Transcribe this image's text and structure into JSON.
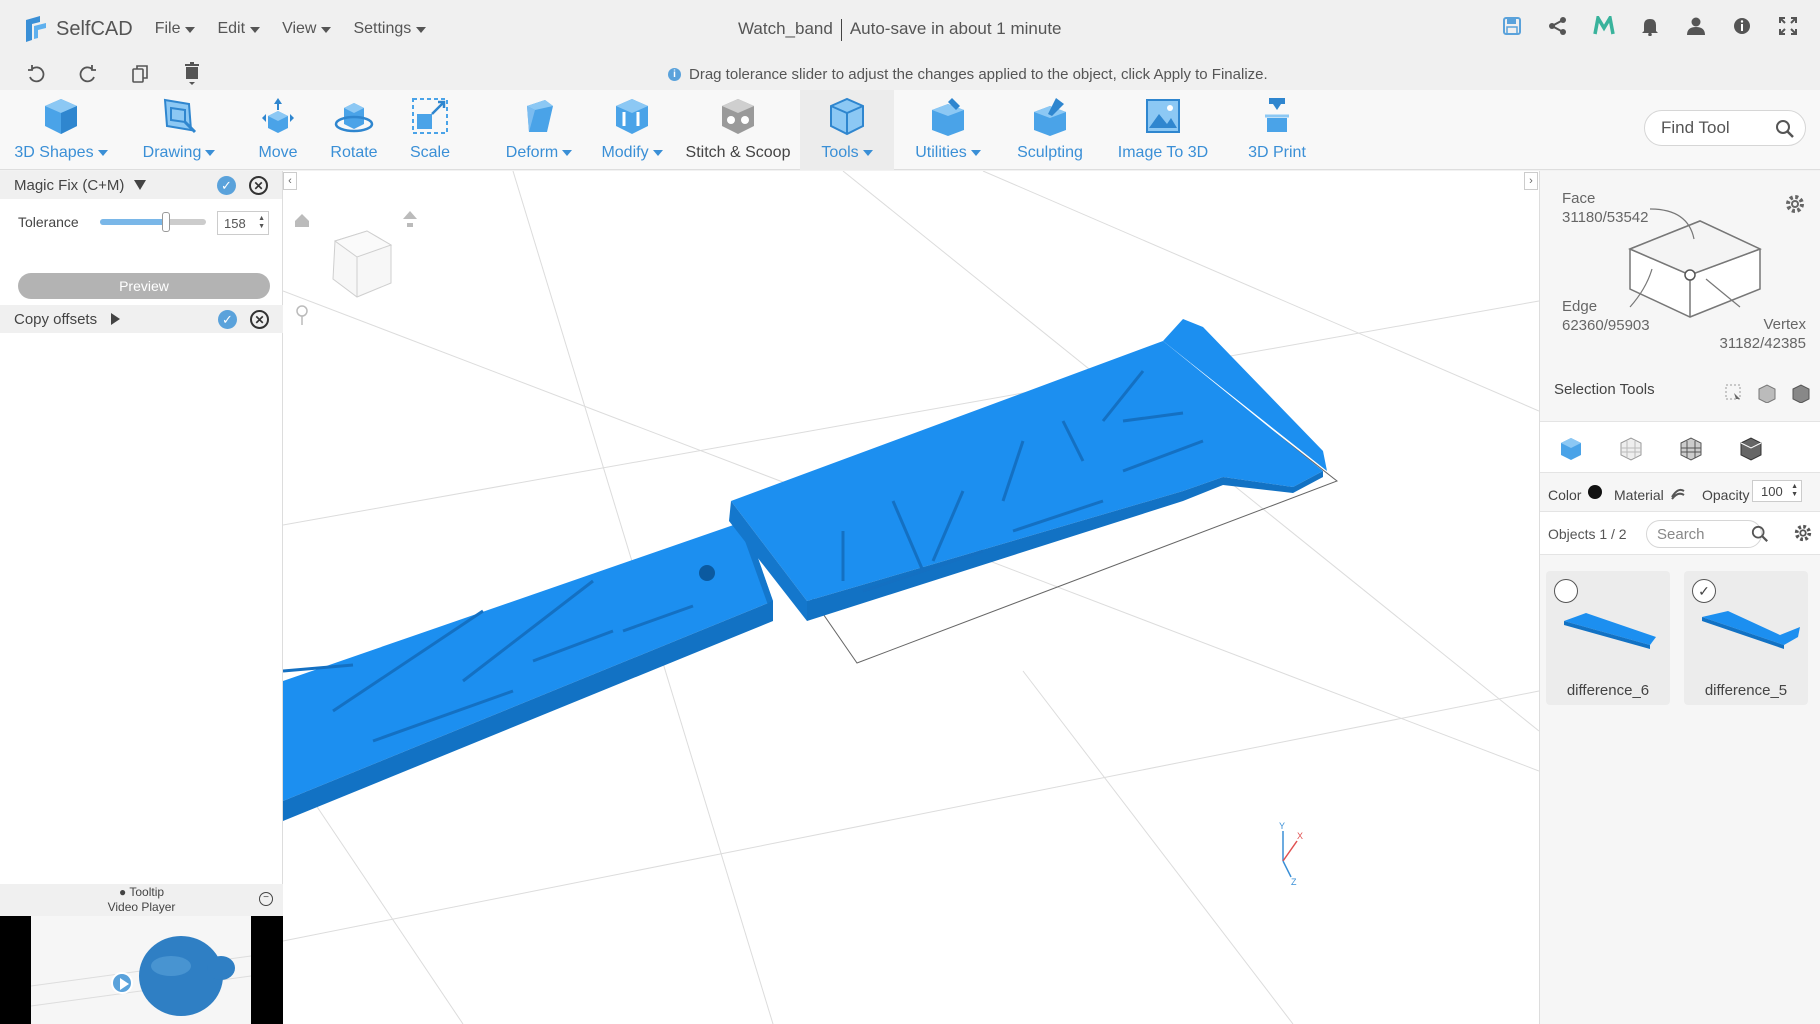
{
  "app": {
    "name": "SelfCAD",
    "file_name": "Watch_band",
    "autosave": "Auto-save in about 1 minute"
  },
  "menus": [
    "File",
    "Edit",
    "View",
    "Settings"
  ],
  "info_message": "Drag tolerance slider to adjust the changes applied to the object, click Apply to Finalize.",
  "toolbar": {
    "tools": [
      {
        "label": "3D Shapes",
        "dropdown": true
      },
      {
        "label": "Drawing",
        "dropdown": true
      },
      {
        "label": "Move",
        "dropdown": false
      },
      {
        "label": "Rotate",
        "dropdown": false
      },
      {
        "label": "Scale",
        "dropdown": false
      },
      {
        "label": "Deform",
        "dropdown": true
      },
      {
        "label": "Modify",
        "dropdown": true
      },
      {
        "label": "Stitch & Scoop",
        "dropdown": false
      },
      {
        "label": "Tools",
        "dropdown": true
      },
      {
        "label": "Utilities",
        "dropdown": true
      },
      {
        "label": "Sculpting",
        "dropdown": false
      },
      {
        "label": "Image To 3D",
        "dropdown": false
      },
      {
        "label": "3D Print",
        "dropdown": false
      }
    ],
    "find_tool_placeholder": "Find Tool"
  },
  "left_panel": {
    "magic_fix_title": "Magic Fix (C+M)",
    "tolerance_label": "Tolerance",
    "tolerance_value": "158",
    "tolerance_fraction": 0.62,
    "preview_label": "Preview",
    "copy_offsets_title": "Copy offsets",
    "tooltip_label": "Tooltip",
    "video_player_label": "Video Player"
  },
  "right_panel": {
    "face_label": "Face",
    "face_value": "31180/53542",
    "edge_label": "Edge",
    "edge_value": "62360/95903",
    "vertex_label": "Vertex",
    "vertex_value": "31182/42385",
    "selection_tools_label": "Selection Tools",
    "color_label": "Color",
    "material_label": "Material",
    "opacity_label": "Opacity",
    "opacity_value": "100",
    "objects_label": "Objects 1 / 2",
    "search_placeholder": "Search",
    "objects": [
      {
        "name": "difference_6",
        "checked": false
      },
      {
        "name": "difference_5",
        "checked": true
      }
    ]
  },
  "colors": {
    "accent": "#3a8fd6",
    "model_blue": "#1e90ee"
  }
}
